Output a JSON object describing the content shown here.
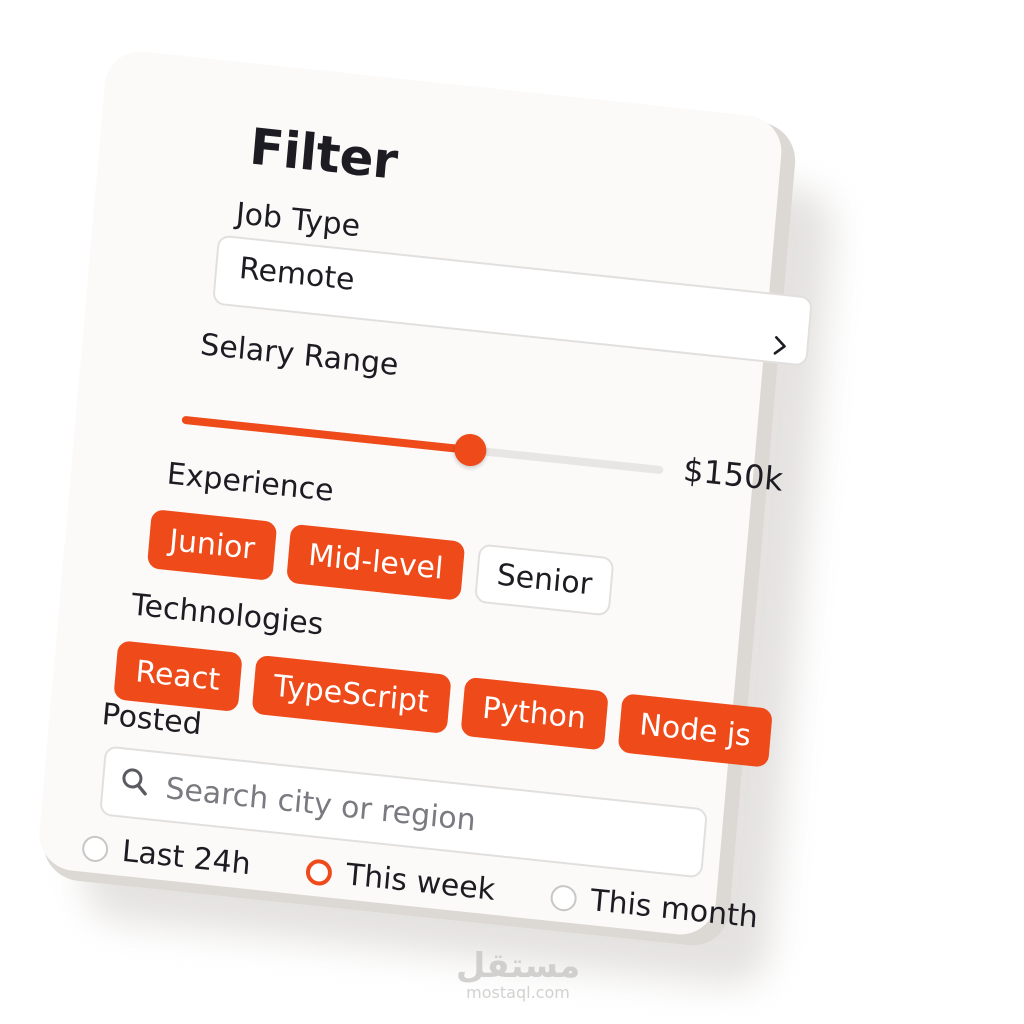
{
  "filter": {
    "title": "Filter",
    "job_type": {
      "label": "Job Type",
      "value": "Remote",
      "chevron": "chevron-right-icon"
    },
    "salary": {
      "label": "Selary Range",
      "value": "$150k",
      "fill_fraction": 0.6
    },
    "experience": {
      "label": "Experience",
      "options": [
        {
          "label": "Junior",
          "selected": true
        },
        {
          "label": "Mid-level",
          "selected": true
        },
        {
          "label": "Senior",
          "selected": false
        }
      ]
    },
    "technologies": {
      "label": "Technologies",
      "options": [
        {
          "label": "React",
          "selected": true
        },
        {
          "label": "TypeScript",
          "selected": true
        },
        {
          "label": "Python",
          "selected": true
        },
        {
          "label": "Node js",
          "selected": true
        }
      ]
    },
    "posted": {
      "label": "Posted",
      "search_placeholder": "Search city or region",
      "search_icon": "search-icon",
      "options": [
        {
          "label": "Last 24h",
          "checked": false
        },
        {
          "label": "This week",
          "checked": true
        },
        {
          "label": "This month",
          "checked": false
        }
      ]
    }
  },
  "colors": {
    "accent": "#ef4a1a",
    "text": "#1c1c22",
    "border": "#e2e0de",
    "card": "#fbfaf9",
    "placeholder": "#7a7a80"
  },
  "watermark": {
    "logo": "مستقل",
    "url": "mostaql.com"
  }
}
